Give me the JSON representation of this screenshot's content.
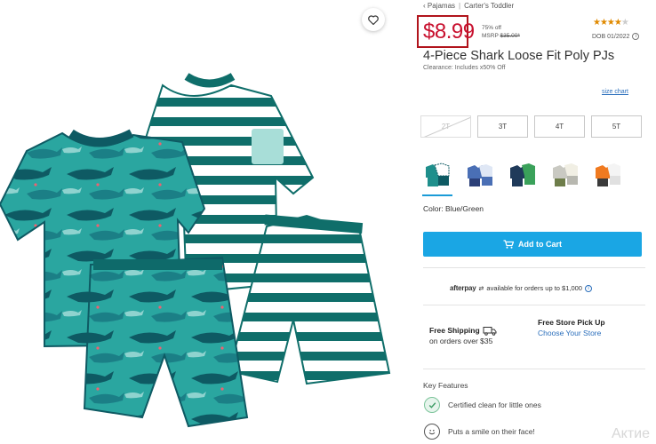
{
  "breadcrumb": [
    "‹ Pajamas",
    "Carter's Toddler"
  ],
  "price": {
    "current": "$8.99",
    "discount": "75% off",
    "msrp_label": "MSRP",
    "msrp_value": "$35.00*"
  },
  "rating": {
    "stars": 4.5,
    "max": 5
  },
  "dob": "DOB 01/2022",
  "product": {
    "title": "4-Piece Shark Loose Fit Poly PJs",
    "clearance_note": "Clearance: Includes x50% Off"
  },
  "size_chart_label": "size chart",
  "sizes": [
    {
      "label": "2T",
      "available": false
    },
    {
      "label": "3T",
      "available": true
    },
    {
      "label": "4T",
      "available": true
    },
    {
      "label": "5T",
      "available": true
    }
  ],
  "swatches": [
    {
      "name": "Blue/Green",
      "selected": true,
      "colors": [
        "#1f8f8c",
        "#0e5a63"
      ]
    },
    {
      "name": "Blue",
      "selected": false,
      "colors": [
        "#4a6fb5",
        "#2b3f78"
      ]
    },
    {
      "name": "Navy",
      "selected": false,
      "colors": [
        "#1f3a5a",
        "#3aa15a"
      ]
    },
    {
      "name": "Grey",
      "selected": false,
      "colors": [
        "#b8b8b0",
        "#6e7d4a"
      ]
    },
    {
      "name": "Orange",
      "selected": false,
      "colors": [
        "#f07a20",
        "#3a3a3a"
      ]
    }
  ],
  "color_label": "Color: Blue/Green",
  "add_to_cart_label": "Add to Cart",
  "afterpay": {
    "brand": "afterpay",
    "text": "available for orders up to $1,000"
  },
  "shipping": {
    "title": "Free Shipping",
    "detail": "on orders over $35"
  },
  "pickup": {
    "title": "Free Store Pick Up",
    "link": "Choose Your Store"
  },
  "key_features": {
    "title": "Key Features",
    "items": [
      "Certified clean for little ones",
      "Puts a smile on their face!"
    ]
  },
  "watermark": "Актие",
  "colors": {
    "price_red": "#c8102e",
    "cart_blue": "#1aa6e4",
    "link_blue": "#2a6ebb",
    "teal": "#0f6e6a",
    "star": "#e08a00"
  },
  "icons": [
    "heart-icon",
    "cart-icon",
    "truck-icon",
    "info-icon",
    "leaf-check-icon",
    "smile-icon"
  ]
}
